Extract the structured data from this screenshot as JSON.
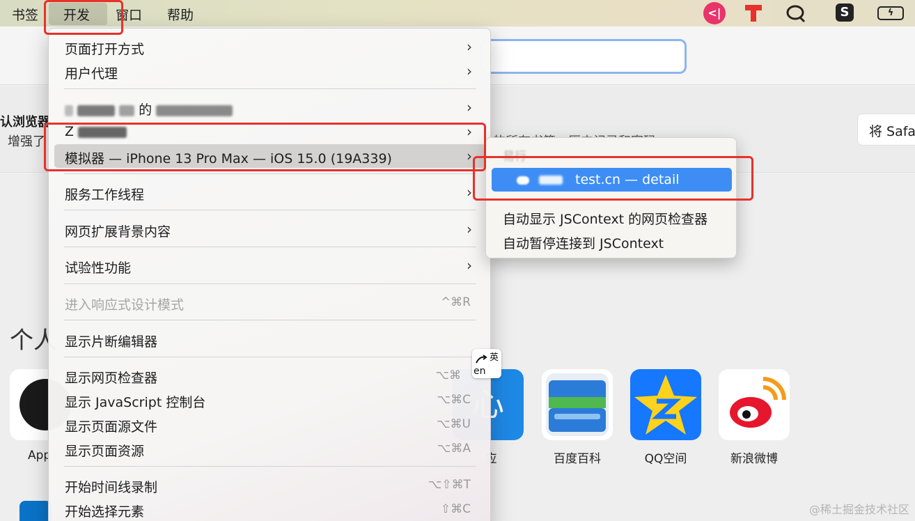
{
  "menubar": {
    "items": [
      "书签",
      "开发",
      "窗口",
      "帮助"
    ],
    "tray": {
      "notify_glyph": "<|",
      "s_glyph": "S",
      "battery_glyph": "ϟ"
    }
  },
  "banner": {
    "title": "认浏览器",
    "body_left": "增强了",
    "body_right": "的所有书签、历史记录和密码",
    "button": "将 Safa"
  },
  "favorites": {
    "title": "个人",
    "tiles": [
      {
        "label": "App",
        "icon": "apple-icon"
      },
      {
        "label": "应",
        "icon": "app-icon",
        "glyph": "心"
      },
      {
        "label": "百度百科",
        "icon": "baidu-baike-icon"
      },
      {
        "label": "QQ空间",
        "icon": "qq-zone-icon"
      },
      {
        "label": "新浪微博",
        "icon": "sina-weibo-icon"
      }
    ]
  },
  "develop_menu": {
    "open_page_with": "页面打开方式",
    "user_agent": "用户代理",
    "device_1_suffix": "的",
    "device_2_prefix": "Z",
    "simulator": "模拟器 — iPhone 13 Pro Max — iOS 15.0 (19A339)",
    "service_workers": "服务工作线程",
    "web_extension_bg": "网页扩展背景内容",
    "experimental": "试验性功能",
    "responsive_mode": "进入响应式设计模式",
    "responsive_mode_shortcut": "^⌘R",
    "snippet_editor": "显示片断编辑器",
    "web_inspector": "显示网页检查器",
    "web_inspector_shortcut": "⌥⌘",
    "js_console": "显示 JavaScript 控制台",
    "js_console_shortcut": "⌥⌘C",
    "page_source": "显示页面源文件",
    "page_source_shortcut": "⌥⌘U",
    "page_resources": "显示页面资源",
    "page_resources_shortcut": "⌥⌘A",
    "timeline": "开始时间线录制",
    "timeline_shortcut": "⌥⇧⌘T",
    "select_element": "开始选择元素",
    "select_element_shortcut": "⇧⌘C",
    "chevron": "›"
  },
  "sub_menu": {
    "header": "易行",
    "page_item": "test.cn — detail",
    "auto_inspect": "自动显示 JSContext 的网页检查器",
    "auto_pause": "自动暂停连接到 JSContext"
  },
  "ime": {
    "top": "英",
    "bottom": "en"
  },
  "watermark": "@稀土掘金技术社区",
  "colors": {
    "highlight": "#3d8df5",
    "annotation": "#e8312a",
    "menubar": "#e4e2c4"
  }
}
